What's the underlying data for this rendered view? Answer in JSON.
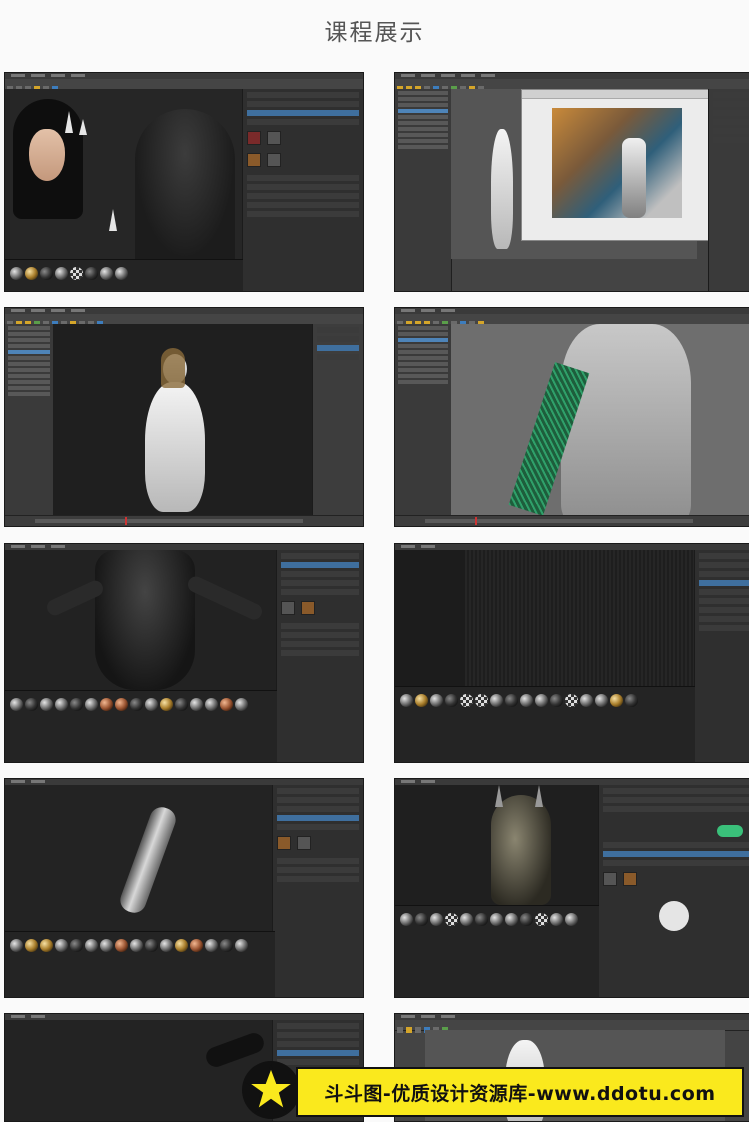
{
  "page": {
    "title": "课程展示"
  },
  "gallery": {
    "screens": [
      {
        "id": "s1",
        "app": "Substance Painter"
      },
      {
        "id": "s2",
        "app": "Maya"
      },
      {
        "id": "s3",
        "app": "Maya"
      },
      {
        "id": "s4",
        "app": "Maya"
      },
      {
        "id": "s5",
        "app": "Substance Painter"
      },
      {
        "id": "s6",
        "app": "Substance Painter"
      },
      {
        "id": "s7",
        "app": "Substance Painter"
      },
      {
        "id": "s8",
        "app": "Substance Painter"
      },
      {
        "id": "s9",
        "app": "Substance Painter"
      },
      {
        "id": "s10",
        "app": "Maya"
      }
    ]
  },
  "watermark": {
    "text": "斗斗图-优质设计资源库-www.ddotu.com",
    "background": "#fae91d",
    "icon": "star-icon"
  }
}
